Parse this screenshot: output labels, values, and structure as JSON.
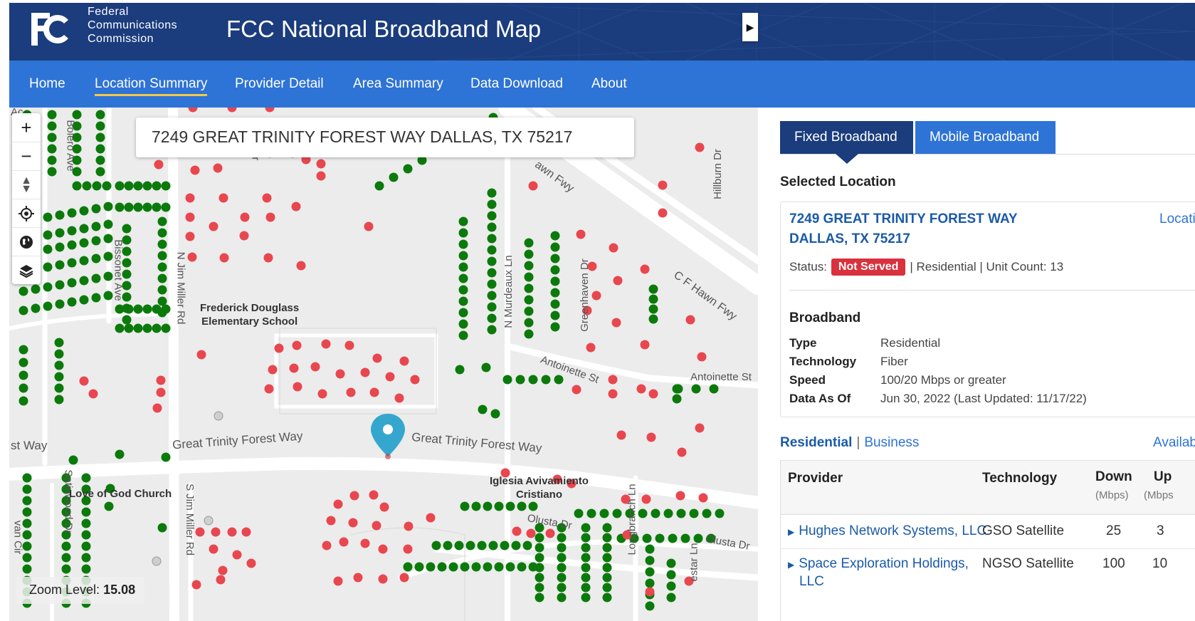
{
  "header": {
    "agency_line1": "Federal",
    "agency_line2": "Communications",
    "agency_line3": "Commission",
    "site_title": "FCC National Broadband Map"
  },
  "nav": {
    "items": [
      {
        "label": "Home",
        "active": false
      },
      {
        "label": "Location Summary",
        "active": true
      },
      {
        "label": "Provider Detail",
        "active": false
      },
      {
        "label": "Area Summary",
        "active": false
      },
      {
        "label": "Data Download",
        "active": false
      },
      {
        "label": "About",
        "active": false
      }
    ]
  },
  "map": {
    "search_value": "7249 GREAT TRINITY FOREST WAY DALLAS, TX 75217",
    "zoom_label": "Zoom Level:",
    "zoom_value": "15.08",
    "controls": [
      "zoom-in-icon",
      "zoom-out-icon",
      "compass-icon",
      "locate-icon",
      "globe-icon",
      "layers-icon"
    ],
    "streets": {
      "great_trinity_1": "Great Trinity Forest Way",
      "great_trinity_2": "Great Trinity Forest Way",
      "st_way": "st Way",
      "jim_miller_n": "N Jim Miller Rd",
      "jim_miller_s": "S Jim Miller Rd",
      "bolero": "Bolero Ave",
      "bissonet": "Bissonet Ave",
      "murdeaux": "N Murdeaux Ln",
      "greenhaven": "Greenhaven Dr",
      "hillburn": "Hillburn Dr",
      "cf_hawn": "C F Hawn Fwy",
      "hawn_fwy": "awn Fwy",
      "antoinette_1": "Antoinette St",
      "antoinette_2": "Antoinette St",
      "olusta_1": "Olusta Dr",
      "olusta_2": "Olusta Dr",
      "longbranch": "Longbranch Ln",
      "satinwood": "Satinwood Dr",
      "dr_small": "Dr",
      "estar": "estar Ln",
      "van_cir": "van Cir",
      "ac": "Ac"
    },
    "pois": {
      "school_line1": "Frederick Douglass",
      "school_line2": "Elementary School",
      "church": "Love of God Church",
      "iglesia_line1": "Iglesia Avivamiento",
      "iglesia_line2": "Cristiano"
    },
    "colors": {
      "served": "#0b7a0b",
      "not_served": "#e8474f",
      "marker": "#35a7cf"
    }
  },
  "panel": {
    "tabs": [
      {
        "label": "Fixed Broadband",
        "active": true
      },
      {
        "label": "Mobile Broadband",
        "active": false
      }
    ],
    "selected_location_heading": "Selected Location",
    "address_line1": "7249 GREAT TRINITY FOREST WAY",
    "address_line2": "DALLAS, TX 75217",
    "location_link": "Locatio",
    "status_label": "Status:",
    "status_badge": "Not Served",
    "status_rest": "| Residential | Unit Count: 13",
    "broadband_heading": "Broadband",
    "details": [
      {
        "key": "Type",
        "value": "Residential"
      },
      {
        "key": "Technology",
        "value": "Fiber"
      },
      {
        "key": "Speed",
        "value": "100/20 Mbps or greater"
      },
      {
        "key": "Data As Of",
        "value": "Jun 30, 2022 (Last Updated: 11/17/22)"
      }
    ],
    "subtab_residential": "Residential",
    "subtab_separator": "|",
    "subtab_business": "Business",
    "availability_link": "Availabi",
    "table": {
      "col_provider": "Provider",
      "col_technology": "Technology",
      "col_down": "Down",
      "col_down_unit": "(Mbps)",
      "col_up": "Up",
      "col_up_unit": "(Mbps",
      "rows": [
        {
          "provider": "Hughes Network Systems, LLC",
          "provider_line2": "",
          "technology": "GSO Satellite",
          "down": "25",
          "up": "3"
        },
        {
          "provider": "Space Exploration Holdings,",
          "provider_line2": "LLC",
          "technology": "NGSO Satellite",
          "down": "100",
          "up": "10"
        }
      ]
    }
  }
}
